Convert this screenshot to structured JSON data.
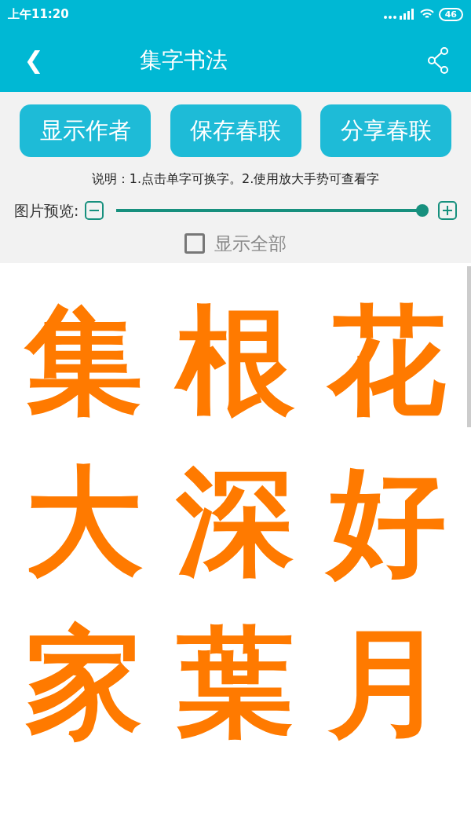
{
  "status_bar": {
    "time": "上午11:20",
    "battery": "46"
  },
  "app_bar": {
    "back": "❮",
    "title": "集字书法"
  },
  "buttons": [
    "显示作者",
    "保存春联",
    "分享春联"
  ],
  "instructions": "说明：1.点击单字可换字。2.使用放大手势可查看字",
  "preview": {
    "label": "图片预览:",
    "level": 0.99
  },
  "show_all": {
    "label": "显示全部",
    "checked": false
  },
  "characters": [
    "集",
    "根",
    "花",
    "大",
    "深",
    "好",
    "家",
    "葉",
    "月"
  ]
}
